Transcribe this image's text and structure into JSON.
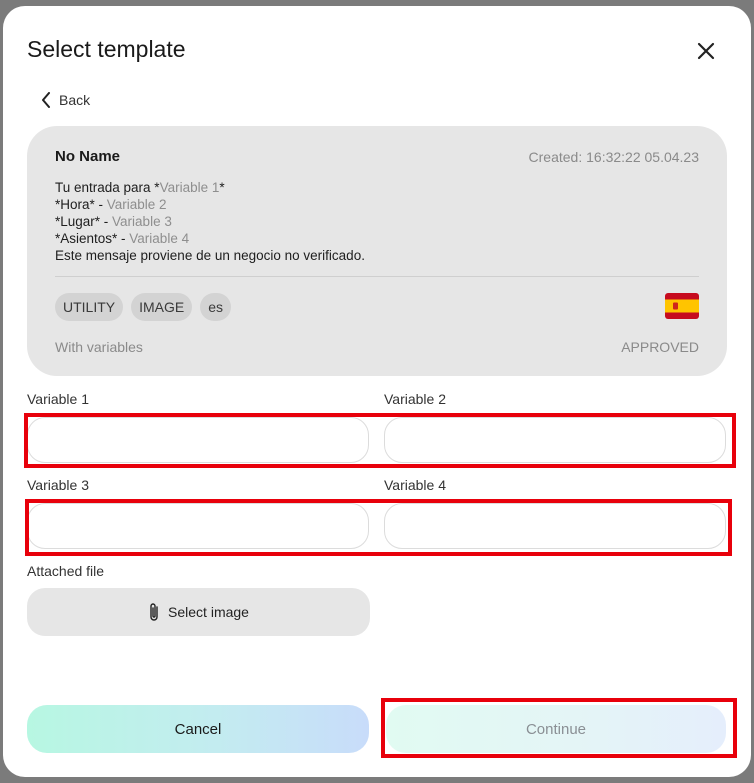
{
  "modal": {
    "title": "Select template",
    "back_label": "Back"
  },
  "template": {
    "name": "No Name",
    "created": "Created: 16:32:22 05.04.23",
    "body_lines": [
      {
        "prefix": "Tu entrada para *",
        "var": "Variable 1",
        "suffix": "*"
      },
      {
        "prefix": "*Hora* - ",
        "var": "Variable 2",
        "suffix": ""
      },
      {
        "prefix": "*Lugar* - ",
        "var": "Variable 3",
        "suffix": ""
      },
      {
        "prefix": "*Asientos* - ",
        "var": "Variable 4",
        "suffix": ""
      },
      {
        "prefix": "Este mensaje proviene de un negocio no verificado.",
        "var": "",
        "suffix": ""
      }
    ],
    "tags": [
      "UTILITY",
      "IMAGE",
      "es"
    ],
    "flag_icon": "spain-flag-icon",
    "variables_note": "With variables",
    "status": "APPROVED"
  },
  "fields": {
    "var1_label": "Variable 1",
    "var2_label": "Variable 2",
    "var3_label": "Variable 3",
    "var4_label": "Variable 4",
    "var1_value": "",
    "var2_value": "",
    "var3_value": "",
    "var4_value": ""
  },
  "attachment": {
    "label": "Attached file",
    "button_label": "Select image",
    "icon": "paperclip-icon"
  },
  "actions": {
    "cancel_label": "Cancel",
    "continue_label": "Continue"
  },
  "colors": {
    "highlight": "#e8000b",
    "card_bg": "#e6e6e6",
    "muted_text": "#8a8a8a"
  }
}
